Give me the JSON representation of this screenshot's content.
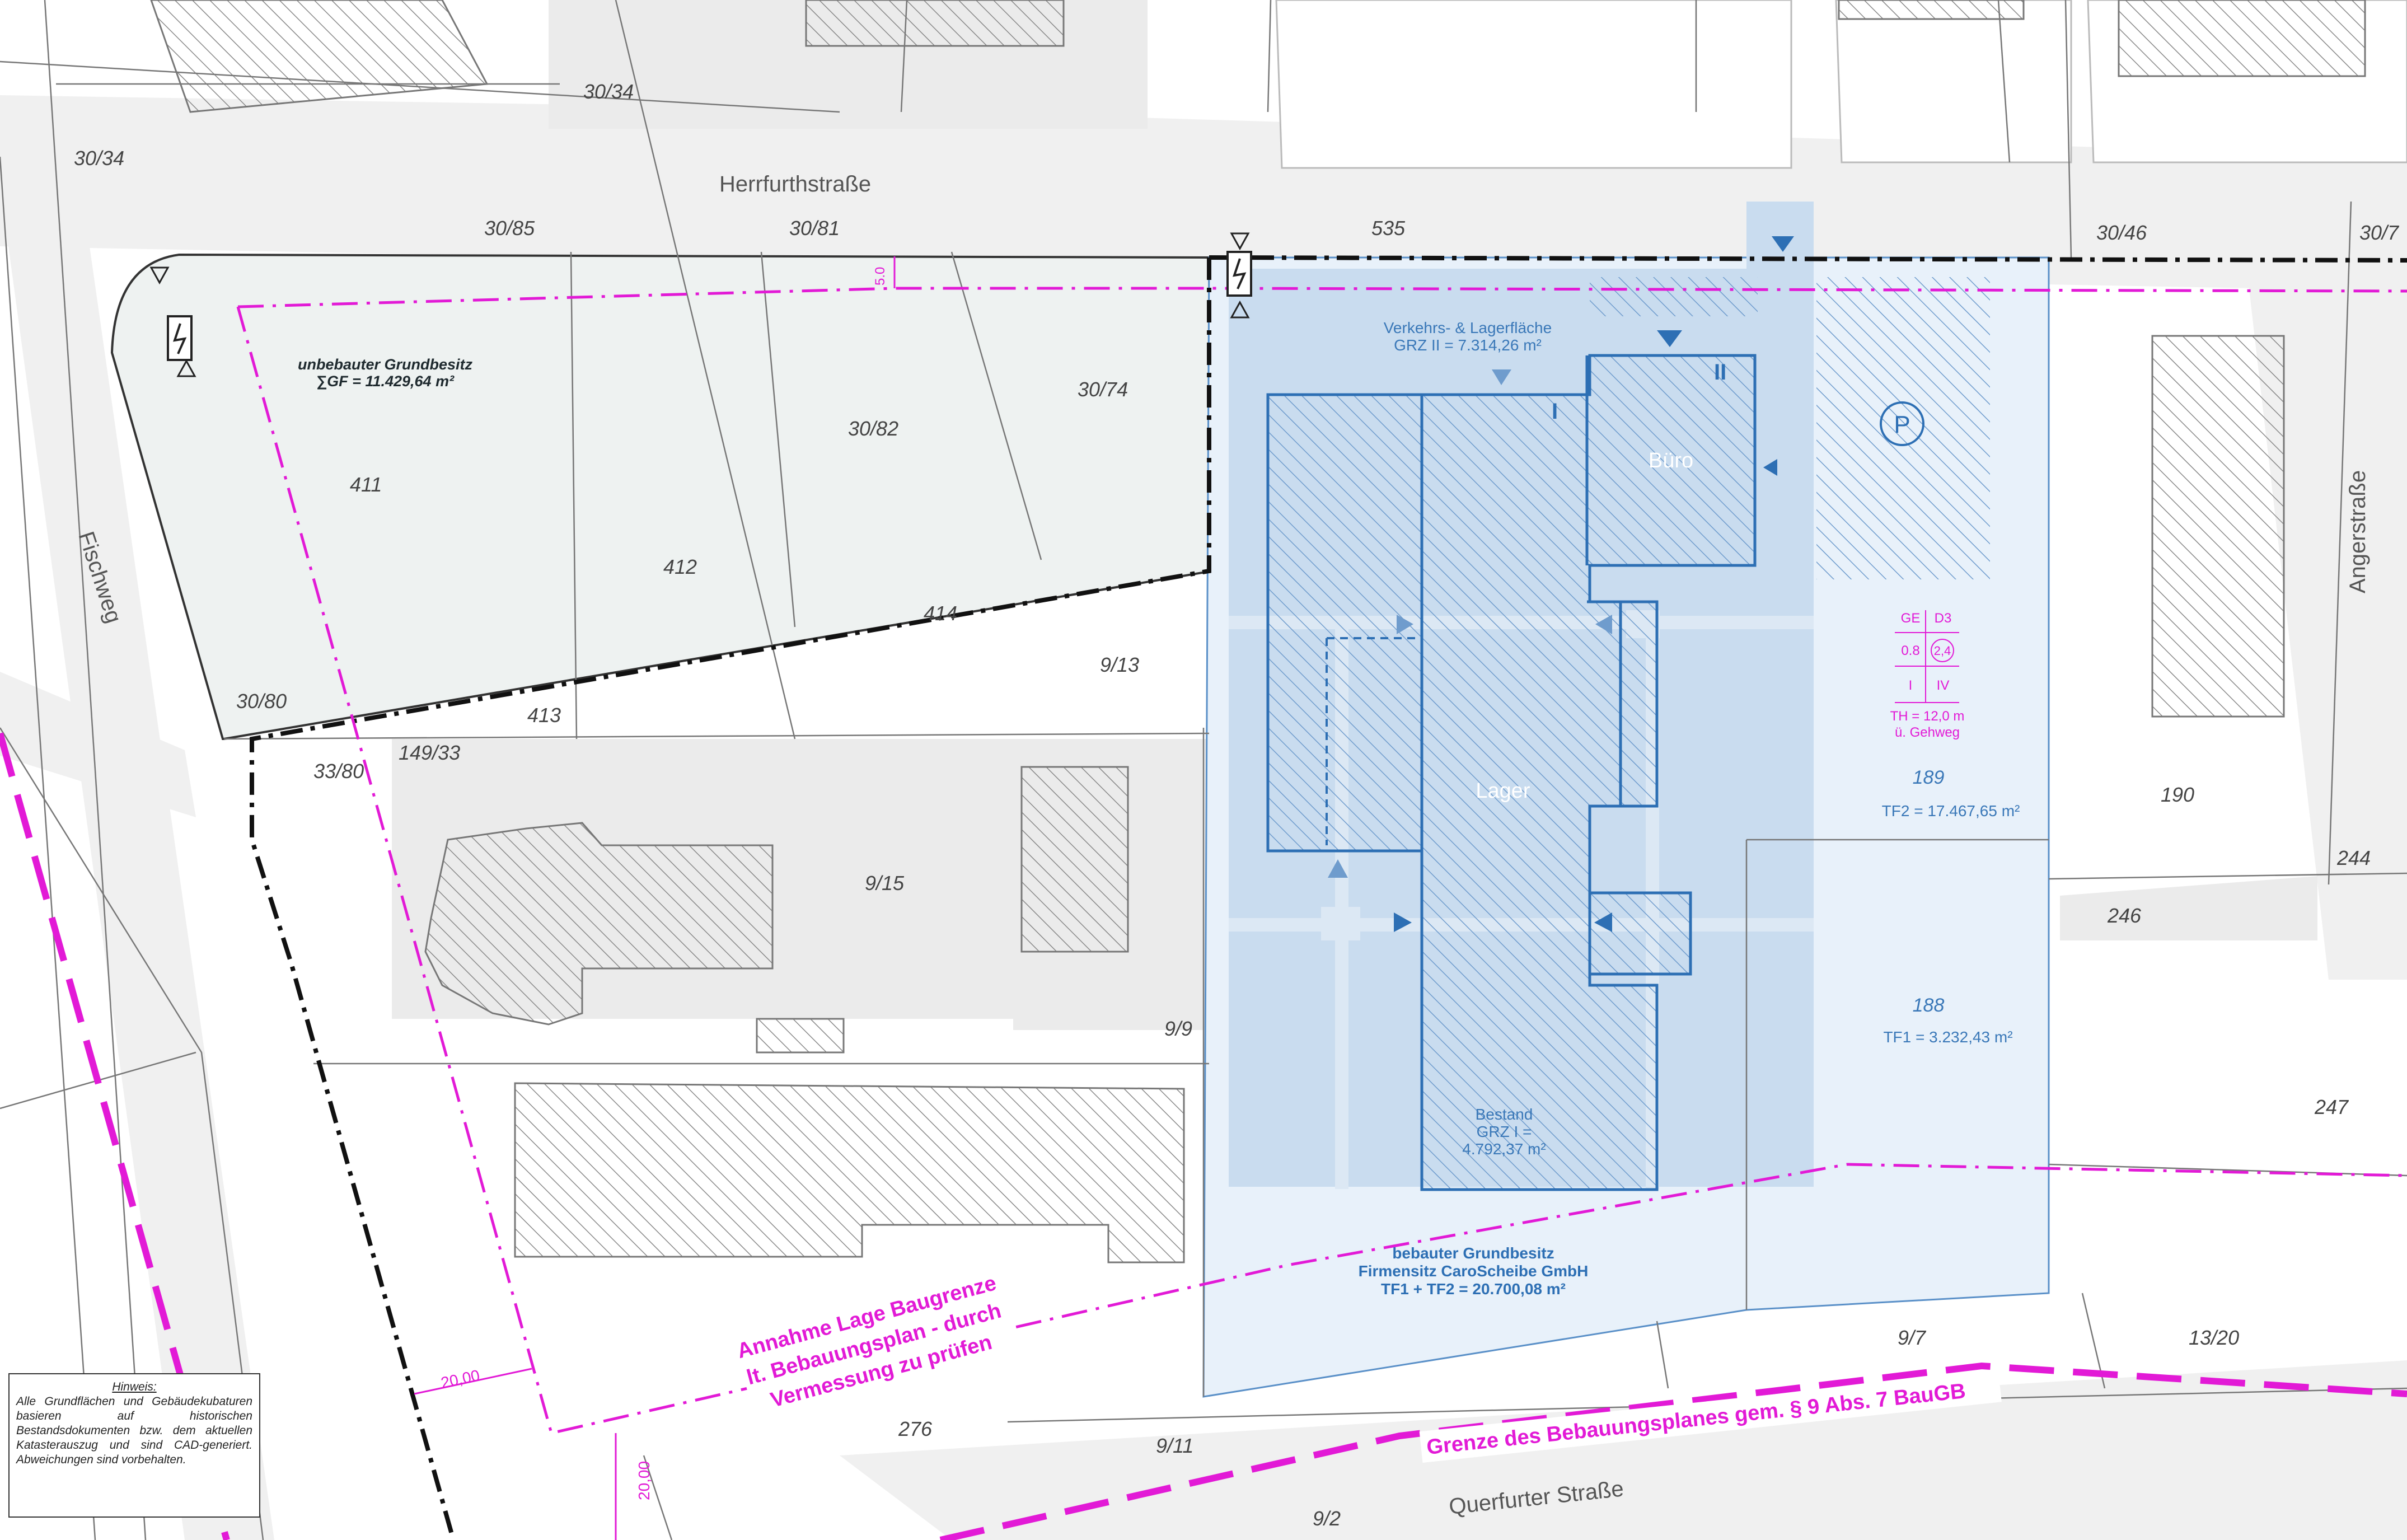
{
  "streets": {
    "herrfurth": "Herrfurthstraße",
    "angerstrasse": "Angerstraße",
    "fischweg": "Fischweg",
    "querfurter": "Querfurter Straße"
  },
  "parcels": {
    "p_30_34_top": "30/34",
    "p_30_34_left": "30/34",
    "p_30_85": "30/85",
    "p_30_81": "30/81",
    "p_535": "535",
    "p_30_46": "30/46",
    "p_30_7": "30/7",
    "p_30_74": "30/74",
    "p_30_82": "30/82",
    "p_411": "411",
    "p_412": "412",
    "p_414": "414",
    "p_9_13": "9/13",
    "p_30_80": "30/80",
    "p_413": "413",
    "p_33_80": "33/80",
    "p_149_33": "149/33",
    "p_9_15": "9/15",
    "p_9_9": "9/9",
    "p_190": "190",
    "p_244": "244",
    "p_246": "246",
    "p_247": "247",
    "p_9_7": "9/7",
    "p_13_20": "13/20",
    "p_276": "276",
    "p_9_11": "9/11",
    "p_9_2": "9/2"
  },
  "labels": {
    "unbebaut_title": "unbebauter Grundbesitz",
    "unbebaut_area": "∑GF = 11.429,64 m²",
    "verkehr_title": "Verkehrs- & Lagerfläche",
    "verkehr_grz": "GRZ II = 7.314,26 m²",
    "roman_1": "I",
    "roman_2": "II",
    "buero": "Büro",
    "lager": "Lager",
    "parking": "P",
    "bestand_1": "Bestand",
    "bestand_2": "GRZ I =",
    "bestand_3": "4.792,37 m²",
    "p189": "189",
    "tf2": "TF2 = 17.467,65 m²",
    "p188": "188",
    "tf1": "TF1 = 3.232,43 m²",
    "bebaut_1": "bebauter Grundbesitz",
    "bebaut_2": "Firmensitz CaroScheibe GmbH",
    "bebaut_3": "TF1 + TF2 = 20.700,08 m²",
    "dim_top": "5.0",
    "dim_20a": "20,00",
    "dim_20b": "20,00",
    "baugrenze_1": "Annahme Lage Baugrenze",
    "baugrenze_2": "lt. Bebauungsplan - durch",
    "baugrenze_3": "Vermessung zu prüfen",
    "grenze": "Grenze des Bebauungsplanes gem. § 9 Abs. 7 BauGB"
  },
  "zoning": {
    "ge": "GE",
    "d3": "D3",
    "grz": "0.8",
    "gfz": "2,4",
    "stories_min": "I",
    "stories_max": "IV",
    "th": "TH = 12,0 m",
    "geh": "ü. Gehweg"
  },
  "note": {
    "title": "Hinweis:",
    "text": "Alle Grundflächen und Gebäudekubaturen basieren auf historischen Bestandsdokumenten bzw. dem aktuellen Katasterauszug und sind CAD-generiert. Abweichungen sind vorbehalten."
  },
  "colors": {
    "magenta": "#e21ad6",
    "blue_label": "#3a78b8",
    "blue_dark": "#2d6fb4",
    "site_light": "#e8f1fa",
    "site_mid": "#c9dcef",
    "unbuilt_fill": "#eef2f1",
    "street_gray": "#f0f0f0",
    "block_gray": "#ebebeb"
  },
  "icons": {
    "substation": "electric-substation-icon",
    "parking": "parking-icon",
    "entrance": "entrance-arrow-icon"
  }
}
